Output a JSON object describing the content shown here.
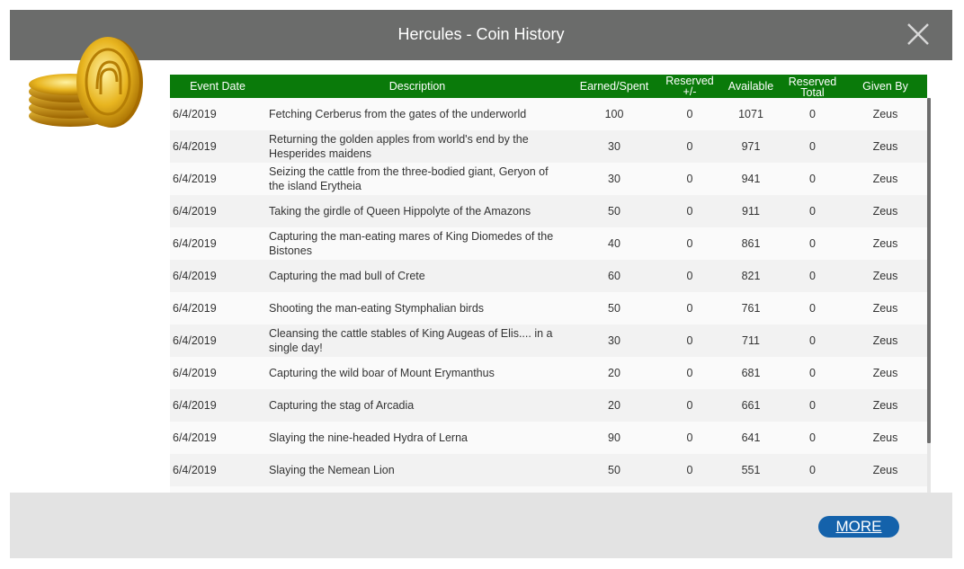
{
  "modal": {
    "title": "Hercules - Coin History",
    "close_icon": "close-icon",
    "logo_icon": "gold-coins-icon"
  },
  "table": {
    "headers": {
      "event_date": "Event Date",
      "description": "Description",
      "earned_spent": "Earned/Spent",
      "reserved": "Reserved +/-",
      "available": "Available",
      "reserved_total": "Reserved Total",
      "given_by": "Given By"
    },
    "rows": [
      {
        "date": "6/4/2019",
        "description": "Fetching Cerberus from the gates of the underworld",
        "earned": "100",
        "reserved": "0",
        "available": "1071",
        "reserved_total": "0",
        "given_by": "Zeus"
      },
      {
        "date": "6/4/2019",
        "description": "Returning the golden apples from world's end by the Hesperides maidens",
        "earned": "30",
        "reserved": "0",
        "available": "971",
        "reserved_total": "0",
        "given_by": "Zeus"
      },
      {
        "date": "6/4/2019",
        "description": "Seizing the cattle from the three-bodied giant, Geryon of the island Erytheia",
        "earned": "30",
        "reserved": "0",
        "available": "941",
        "reserved_total": "0",
        "given_by": "Zeus"
      },
      {
        "date": "6/4/2019",
        "description": "Taking the girdle of Queen Hippolyte of the Amazons",
        "earned": "50",
        "reserved": "0",
        "available": "911",
        "reserved_total": "0",
        "given_by": "Zeus"
      },
      {
        "date": "6/4/2019",
        "description": "Capturing the man-eating mares of King Diomedes of the Bistones",
        "earned": "40",
        "reserved": "0",
        "available": "861",
        "reserved_total": "0",
        "given_by": "Zeus"
      },
      {
        "date": "6/4/2019",
        "description": "Capturing the mad bull of Crete",
        "earned": "60",
        "reserved": "0",
        "available": "821",
        "reserved_total": "0",
        "given_by": "Zeus"
      },
      {
        "date": "6/4/2019",
        "description": "Shooting the man-eating Stymphalian birds",
        "earned": "50",
        "reserved": "0",
        "available": "761",
        "reserved_total": "0",
        "given_by": "Zeus"
      },
      {
        "date": "6/4/2019",
        "description": "Cleansing the cattle stables of King Augeas of Elis.... in a single day!",
        "earned": "30",
        "reserved": "0",
        "available": "711",
        "reserved_total": "0",
        "given_by": "Zeus"
      },
      {
        "date": "6/4/2019",
        "description": "Capturing the wild boar of Mount Erymanthus",
        "earned": "20",
        "reserved": "0",
        "available": "681",
        "reserved_total": "0",
        "given_by": "Zeus"
      },
      {
        "date": "6/4/2019",
        "description": "Capturing the stag of Arcadia",
        "earned": "20",
        "reserved": "0",
        "available": "661",
        "reserved_total": "0",
        "given_by": "Zeus"
      },
      {
        "date": "6/4/2019",
        "description": "Slaying the nine-headed Hydra of Lerna",
        "earned": "90",
        "reserved": "0",
        "available": "641",
        "reserved_total": "0",
        "given_by": "Zeus"
      },
      {
        "date": "6/4/2019",
        "description": "Slaying the Nemean Lion",
        "earned": "50",
        "reserved": "0",
        "available": "551",
        "reserved_total": "0",
        "given_by": "Zeus"
      },
      {
        "date": "",
        "description": "",
        "earned": "",
        "reserved": "",
        "available": "",
        "reserved_total": "",
        "given_by": ""
      }
    ]
  },
  "footer": {
    "more_label": "MORE"
  },
  "colors": {
    "titlebar": "#6b6c6b",
    "header_green": "#0a7a0a",
    "more_button": "#1462ab",
    "footer": "#e3e3e3"
  }
}
